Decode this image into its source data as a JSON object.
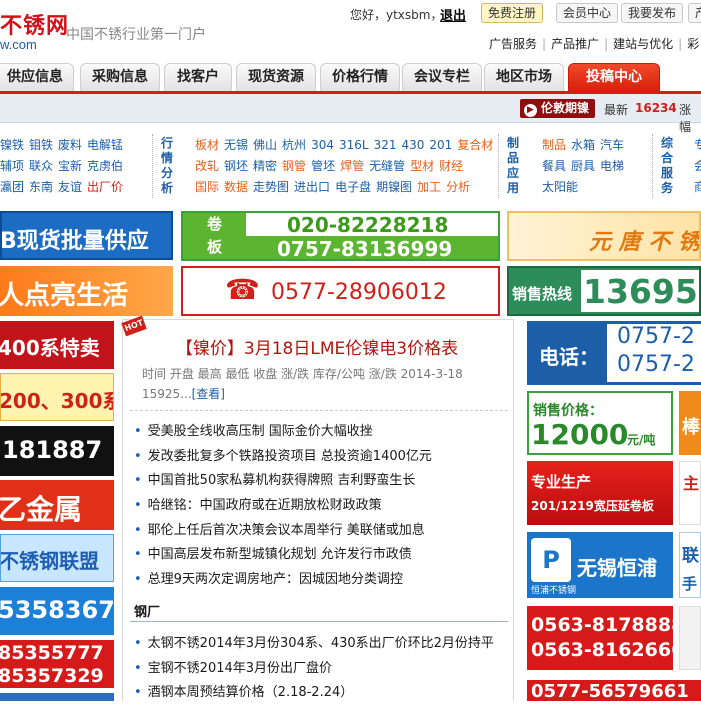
{
  "header": {
    "logo_cn": "不锈网",
    "logo_en": "w.com",
    "slogan": "中国不锈行业第一门户",
    "greeting": "您好，ytxsbm，",
    "logout": "退出",
    "buttons": [
      "免费注册",
      "会员中心",
      "我要发布",
      "产"
    ],
    "sublinks": [
      "广告服务",
      "产品推广",
      "建站与优化",
      "彩"
    ]
  },
  "nav": {
    "tabs": [
      "供应信息",
      "采购信息",
      "找客户",
      "现货资源",
      "价格行情",
      "会议专栏",
      "地区市场",
      "投稿中心"
    ],
    "active": "投稿中心"
  },
  "ticker": {
    "badge": "伦敦期镍",
    "latest_label": "最新",
    "latest_value": "16234",
    "more": "涨幅"
  },
  "categories": {
    "col1": [
      [
        "镍铁",
        "钼铁",
        "废料",
        "电解锰"
      ],
      [
        "辅项",
        "联众",
        "宝新",
        "克虏伯"
      ],
      [
        "瀛团",
        "东南",
        "友谊",
        "出厂价"
      ]
    ],
    "label_market": "行情分析",
    "col2": [
      [
        "板材",
        "无锡",
        "佛山",
        "杭州",
        "304",
        "316L",
        "321",
        "430",
        "201",
        "复合材"
      ],
      [
        "改轧",
        "钢坯",
        "精密",
        "钢管",
        "管坯",
        "焊管",
        "无缝管",
        "型材",
        "财经"
      ],
      [
        "国际",
        "数据",
        "走势图",
        "进出口",
        "电子盘",
        "期镍图",
        "加工",
        "分析"
      ]
    ],
    "label_products": "制品应用",
    "col3": [
      [
        "制品",
        "水箱",
        "汽车"
      ],
      [
        "餐具",
        "厨具",
        "电梯"
      ],
      [
        "太阳能"
      ]
    ],
    "label_service": "综合服务",
    "col4": [
      [
        "专"
      ],
      [
        "会"
      ],
      [
        "商"
      ]
    ]
  },
  "banners": {
    "left": [
      "B现货批量供应",
      "人点亮生活",
      "400系特卖",
      "200、300系",
      "181887",
      "乙金属",
      "不锈钢联盟",
      "5358367",
      "85355777",
      "85357329"
    ],
    "mid_top_labels": [
      "卷",
      "板"
    ],
    "mid_top_phones": [
      "020-82228218",
      "0757-83136999"
    ],
    "mid_phone": "0577-28906012",
    "right_top": "元 唐 不 锈",
    "hotline_label": "销售热线",
    "hotline_number": "13695",
    "right_phone_label": "电话：",
    "right_phones": [
      "0757-2",
      "0757-2"
    ],
    "price_label": "销售价格：",
    "price_value": "12000",
    "price_unit": "元/吨",
    "side_char": "棒",
    "pro_line1": "专业生产",
    "pro_line2": "201/1219宽压延卷板",
    "side_char2": "主",
    "hengpu_name": "无锡恒浦",
    "hengpu_sub": "恒浦不锈钢",
    "side_char3": "联",
    "side_char4": "手",
    "bottom_phones": [
      "0563-8178888",
      "0563-8162666"
    ],
    "last_phone": "0577-56579661"
  },
  "center": {
    "hot": "HOT",
    "headline": "【镍价】3月18日LME伦镍电3价格表",
    "meta": "时间 开盘 最高 最低 收盘 涨/跌 库存/公吨 涨/跌 2014-3-18 15925...",
    "meta_link": "[查看]",
    "news": [
      "受美股全线收高压制 国际金价大幅收挫",
      "发改委批复多个铁路投资项目 总投资逾1400亿元",
      "中国首批50家私募机构获得牌照 吉利野蛮生长",
      "哈继铭：中国政府或在近期放松财政政策",
      "耶伦上任后首次决策会议本周举行 美联储或加息",
      "中国高层发布新型城镇化规划 允许发行市政债",
      "总理9天两次定调房地产：因城因地分类调控"
    ],
    "section": "钢厂",
    "steel_news": [
      "太钢不锈2014年3月份304系、430系出厂价环比2月份持平",
      "宝钢不锈2014年3月份出厂盘价",
      "酒钢本周预结算价格（2.18-2.24）"
    ]
  }
}
